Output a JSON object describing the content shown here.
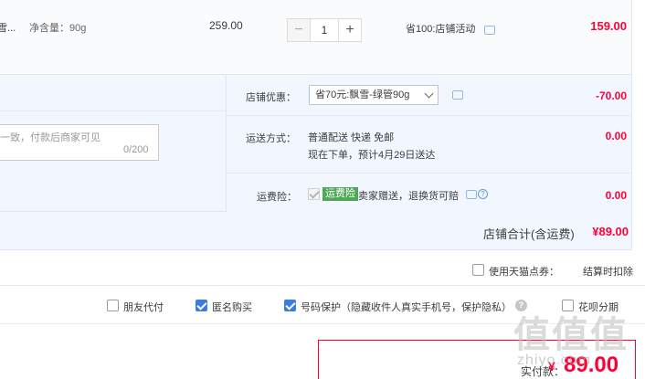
{
  "product": {
    "name_fragment": "郭雪...",
    "spec": "净含量：90g",
    "unit_price": "259.00",
    "quantity": "1",
    "minus_label": "−",
    "plus_label": "+",
    "promotion": "省100:店铺活动",
    "subtotal": "159.00"
  },
  "shop_options": {
    "memo_placeholder": "一致，付款后商家可见",
    "memo_count": "0/200",
    "coupon_label": "店铺优惠：",
    "coupon_selected": "省70元:飘雪-绿管90g",
    "coupon_value": "-70.00",
    "shipping_label": "运送方式：",
    "shipping_method": "普通配送 快递 免邮",
    "shipping_eta": "现在下单，预计4月29日送达",
    "shipping_value": "0.00",
    "insurance_label": "运费险：",
    "insurance_badge": "运费险",
    "insurance_desc": "卖家赠送，退换货可赔",
    "insurance_value": "0.00"
  },
  "shop_total": {
    "label": "店铺合计(含运费)",
    "value": "¥89.00"
  },
  "points": {
    "label": "使用天猫点券：",
    "note": "结算时扣除"
  },
  "bottom_options": {
    "friend_pay": "朋友代付",
    "anonymous": "匿名购买",
    "number_protect": "号码保护（隐藏收件人真实手机号，保护隐私）",
    "huabei": "花呗分期"
  },
  "payment": {
    "label": "实付款：",
    "currency": "¥",
    "amount": "89.00"
  },
  "watermark": {
    "logo": "值值值",
    "url": "zhiyo.com"
  },
  "colors": {
    "accent_red": "#ff0036",
    "panel_blue": "#f2f7ff",
    "checkbox_blue": "#3b7ddd",
    "insurance_green": "#4fa855"
  }
}
